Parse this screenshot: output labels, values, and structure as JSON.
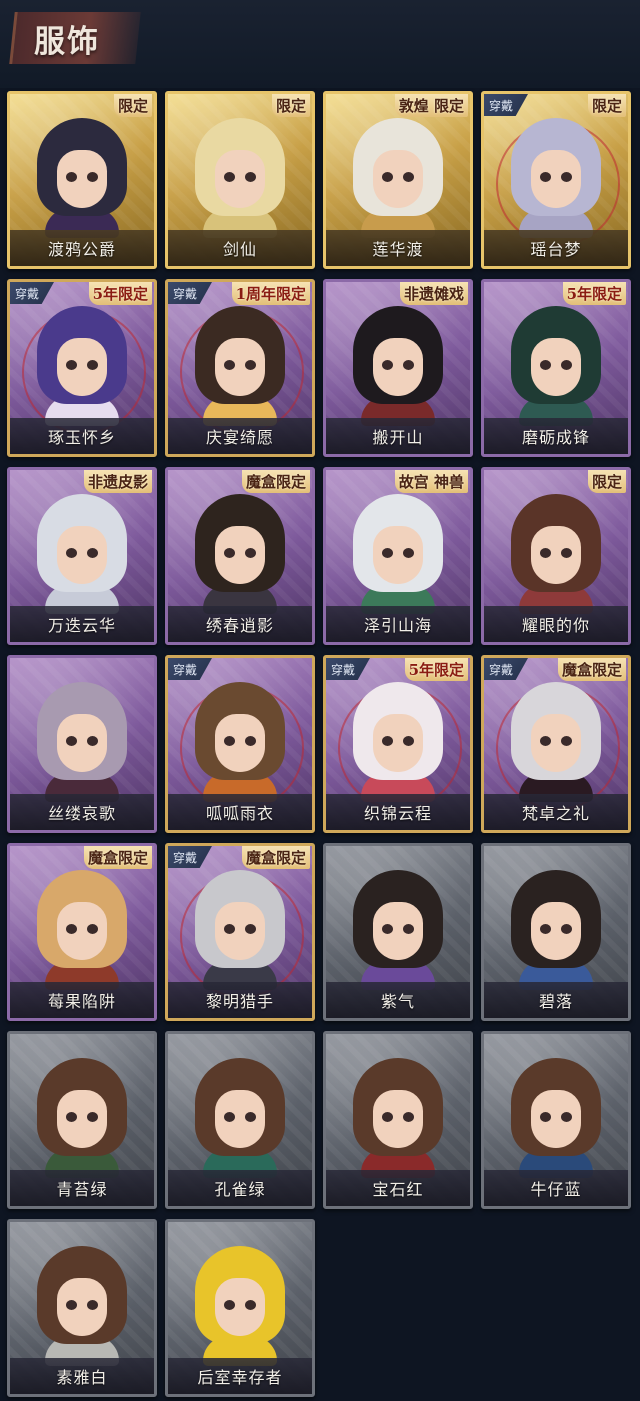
{
  "header": {
    "title": "服饰"
  },
  "colors": {
    "background": "#0e1522",
    "gold_card": "#c8a047",
    "purple_card": "#7e5a9c",
    "gray_card": "#5d626b",
    "worn_tag": "#2e3a58"
  },
  "costumes": [
    {
      "name": "渡鸦公爵",
      "rarity": "gold",
      "badge": "限定",
      "worn": false,
      "hair": "#2c2a3e",
      "outfit": "#3b2a55"
    },
    {
      "name": "剑仙",
      "rarity": "gold",
      "badge": "限定",
      "worn": false,
      "hair": "#e9d9a2",
      "outfit": "#d8c27a"
    },
    {
      "name": "莲华渡",
      "rarity": "gold",
      "badge": "敦煌 限定",
      "worn": false,
      "hair": "#e8e4da",
      "outfit": "#c89c4c"
    },
    {
      "name": "瑶台梦",
      "rarity": "gold",
      "badge": "限定",
      "worn": true,
      "worn_label": "穿戴",
      "hair": "#b7b6d2",
      "outfit": "#a7a4c4"
    },
    {
      "name": "琢玉怀乡",
      "rarity": "purple",
      "badge": "5年限定",
      "worn": true,
      "worn_label": "穿戴",
      "hair": "#4a3a8c",
      "outfit": "#e6dcef"
    },
    {
      "name": "庆宴绮愿",
      "rarity": "purple",
      "badge": "1周年限定",
      "worn": true,
      "worn_label": "穿戴",
      "hair": "#3b2a22",
      "outfit": "#e8b75a"
    },
    {
      "name": "搬开山",
      "rarity": "purple",
      "badge": "非遗傩戏",
      "worn": false,
      "hair": "#1e1a1e",
      "outfit": "#7a2a2a"
    },
    {
      "name": "磨砺成锋",
      "rarity": "purple",
      "badge": "5年限定",
      "worn": false,
      "hair": "#1f3b34",
      "outfit": "#2e5a52"
    },
    {
      "name": "万迭云华",
      "rarity": "purple",
      "badge": "非遗皮影",
      "worn": false,
      "hair": "#d8dce4",
      "outfit": "#c7cbd8"
    },
    {
      "name": "绣春逍影",
      "rarity": "purple",
      "badge": "魔盒限定",
      "worn": false,
      "hair": "#2e241e",
      "outfit": "#3a3540"
    },
    {
      "name": "泽引山海",
      "rarity": "purple",
      "badge": "故宫 神兽",
      "worn": false,
      "hair": "#e3e6ea",
      "outfit": "#3c7a5a"
    },
    {
      "name": "耀眼的你",
      "rarity": "purple",
      "badge": "限定",
      "worn": false,
      "hair": "#5a3428",
      "outfit": "#8e3a3a"
    },
    {
      "name": "丝缕哀歌",
      "rarity": "purple",
      "badge": "",
      "worn": false,
      "hair": "#a89ab0",
      "outfit": "#4a2a3a"
    },
    {
      "name": "呱呱雨衣",
      "rarity": "purple",
      "badge": "",
      "worn": true,
      "worn_label": "穿戴",
      "hair": "#6a4a30",
      "outfit": "#c86a2a"
    },
    {
      "name": "织锦云程",
      "rarity": "purple",
      "badge": "5年限定",
      "worn": true,
      "worn_label": "穿戴",
      "hair": "#efe8ec",
      "outfit": "#c84a5a"
    },
    {
      "name": "梵卓之礼",
      "rarity": "purple",
      "badge": "魔盒限定",
      "worn": true,
      "worn_label": "穿戴",
      "hair": "#d8d6da",
      "outfit": "#2a1a22"
    },
    {
      "name": "莓果陷阱",
      "rarity": "purple",
      "badge": "魔盒限定",
      "worn": false,
      "hair": "#d8a86a",
      "outfit": "#8e3a2a"
    },
    {
      "name": "黎明猎手",
      "rarity": "purple",
      "badge": "魔盒限定",
      "worn": true,
      "worn_label": "穿戴",
      "hair": "#c8c8cc",
      "outfit": "#3a3a48"
    },
    {
      "name": "紫气",
      "rarity": "gray",
      "badge": "",
      "worn": false,
      "hair": "#2a2220",
      "outfit": "#6a4a9a"
    },
    {
      "name": "碧落",
      "rarity": "gray",
      "badge": "",
      "worn": false,
      "hair": "#2a2220",
      "outfit": "#3a5a9a"
    },
    {
      "name": "青苔绿",
      "rarity": "gray",
      "badge": "",
      "worn": false,
      "hair": "#5a3a2a",
      "outfit": "#3a5a3a"
    },
    {
      "name": "孔雀绿",
      "rarity": "gray",
      "badge": "",
      "worn": false,
      "hair": "#5a3a2a",
      "outfit": "#2a6a5a"
    },
    {
      "name": "宝石红",
      "rarity": "gray",
      "badge": "",
      "worn": false,
      "hair": "#5a3a2a",
      "outfit": "#8a2a2a"
    },
    {
      "name": "牛仔蓝",
      "rarity": "gray",
      "badge": "",
      "worn": false,
      "hair": "#5a3a2a",
      "outfit": "#2a4a7a"
    },
    {
      "name": "素雅白",
      "rarity": "gray",
      "badge": "",
      "worn": false,
      "hair": "#5a3a2a",
      "outfit": "#b8b8b4"
    },
    {
      "name": "后室幸存者",
      "rarity": "gray",
      "badge": "",
      "worn": false,
      "hair": "#e8c42a",
      "outfit": "#e8c42a"
    }
  ]
}
